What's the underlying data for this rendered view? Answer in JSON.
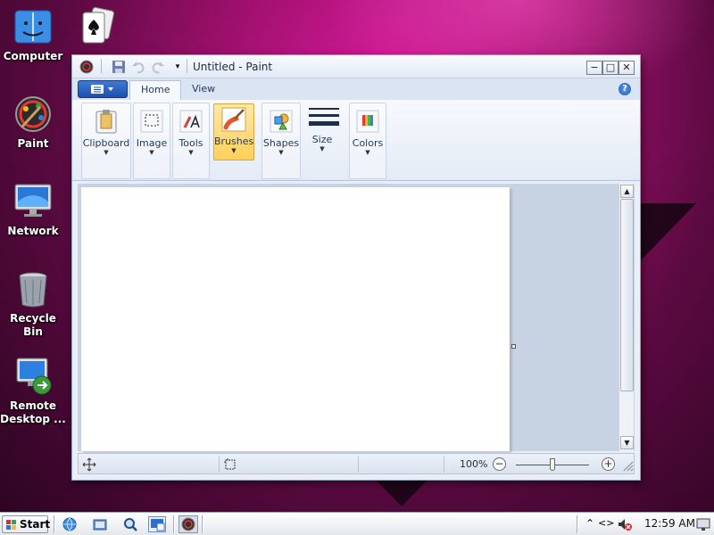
{
  "desktop": {
    "icons": [
      {
        "label": "Computer",
        "icon": "computer-icon"
      },
      {
        "label": "Paint",
        "icon": "paint-icon"
      },
      {
        "label": "Network",
        "icon": "network-icon"
      },
      {
        "label": "Recycle Bin",
        "icon": "recycle-bin-icon"
      },
      {
        "label": "Remote Desktop ...",
        "icon": "remote-desktop-icon"
      }
    ],
    "extra_icon": "solitaire-icon"
  },
  "window": {
    "title": "Untitled - Paint",
    "controls": {
      "minimize": "−",
      "maximize": "□",
      "close": "✕"
    },
    "tabs": [
      {
        "label": "Home",
        "active": true
      },
      {
        "label": "View",
        "active": false
      }
    ],
    "help": "?",
    "ribbon": {
      "groups": [
        {
          "label": "Clipboard",
          "icon": "clipboard-icon"
        },
        {
          "label": "Image",
          "icon": "image-select-icon"
        },
        {
          "label": "Tools",
          "icon": "tools-icon"
        },
        {
          "label": "Brushes",
          "icon": "brush-icon",
          "highlighted": true
        },
        {
          "label": "Shapes",
          "icon": "shapes-icon"
        },
        {
          "label": "Size",
          "icon": "line-size-icon"
        },
        {
          "label": "Colors",
          "icon": "colors-icon"
        }
      ]
    },
    "status": {
      "zoom": "100%",
      "zoom_out": "−",
      "zoom_in": "+",
      "zoom_level": 0.5
    }
  },
  "taskbar": {
    "start_label": "Start",
    "clock": "12:59 AM"
  },
  "colors": {
    "accent": "#1d4fa8",
    "hot_button": "#ffcf5a",
    "desktop": "#a0106e"
  }
}
